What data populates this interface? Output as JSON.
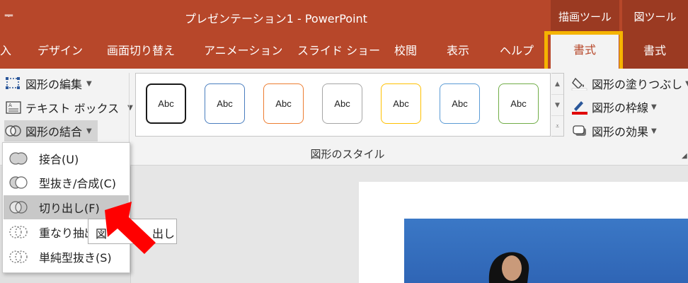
{
  "titlebar": {
    "qat_glyph": "ᆕ",
    "title": "プレゼンテーション1 - PowerPoint",
    "ctx_drawing_tools": "描画ツール",
    "ctx_picture_tools": "図ツール"
  },
  "tabs": {
    "items": [
      "入",
      "デザイン",
      "画面切り替え",
      "アニメーション",
      "スライド ショー",
      "校閲",
      "表示",
      "ヘルプ"
    ],
    "active": "書式",
    "ctx_format": "書式"
  },
  "ribbon": {
    "insert_shapes": {
      "edit_shape": "図形の編集",
      "text_box": "テキスト ボックス",
      "merge_shapes": "図形の結合"
    },
    "shape_styles": {
      "group_label": "図形のスタイル",
      "sample_text": "Abc",
      "samples": [
        {
          "border": "#1a1a1a"
        },
        {
          "border": "#4a7ebf"
        },
        {
          "border": "#ed7d31"
        },
        {
          "border": "#a5a5a5"
        },
        {
          "border": "#ffc000"
        },
        {
          "border": "#5b9bd5"
        },
        {
          "border": "#70ad47"
        }
      ],
      "shape_fill": "図形の塗りつぶし",
      "shape_outline": "図形の枠線",
      "shape_effects": "図形の効果"
    }
  },
  "merge_menu": {
    "items": [
      "接合(U)",
      "型抜き/合成(C)",
      "切り出し(F)",
      "重なり抽出",
      "単純型抜き(S)"
    ],
    "highlighted_index": 2,
    "tooltip": "図　　　　出し"
  },
  "colors": {
    "accent": "#b7472a",
    "contextual": "#9b3a22",
    "highlight": "#f5b400",
    "arrow": "#ff0000"
  }
}
